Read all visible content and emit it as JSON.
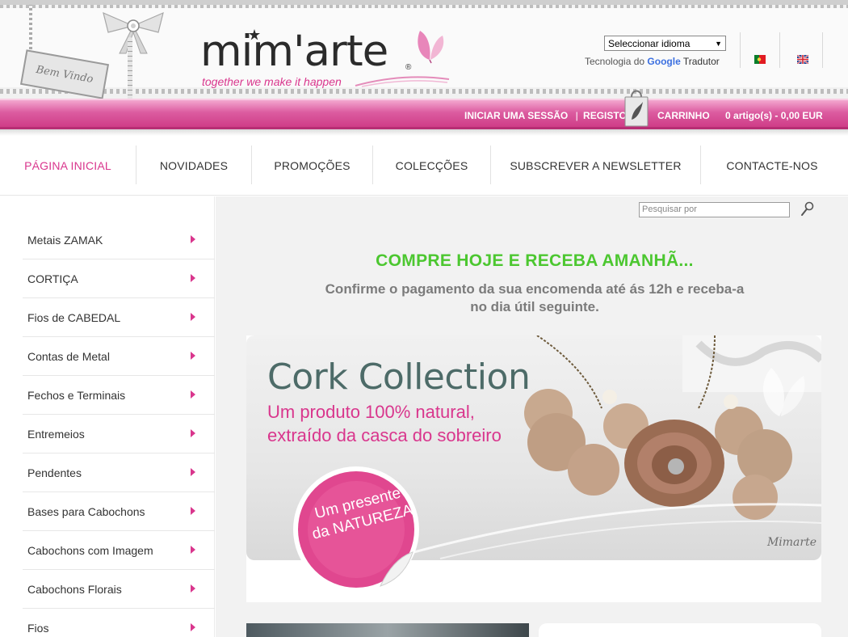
{
  "header": {
    "welcome_tag": "Bem Vindo",
    "logo_text": "mim'arte",
    "logo_reg": "®",
    "tagline": "together we make it happen",
    "language_select": {
      "selected": "Seleccionar idioma"
    },
    "powered_by": {
      "prefix": "Tecnologia do",
      "google": "Google",
      "suffix": "Tradutor"
    },
    "flags": [
      "portugal-flag-icon",
      "uk-flag-icon"
    ]
  },
  "topbar": {
    "login": "INICIAR UMA SESSÃO",
    "divider": "|",
    "register": "REGISTO",
    "cart_label": "CARRINHO",
    "cart_amount": "0 artigo(s) - 0,00 EUR"
  },
  "nav": {
    "items": [
      {
        "label": "PÁGINA INICIAL",
        "active": true
      },
      {
        "label": "NOVIDADES"
      },
      {
        "label": "PROMOÇÕES"
      },
      {
        "label": "COLECÇÕES"
      },
      {
        "label": "SUBSCREVER A NEWSLETTER"
      },
      {
        "label": "CONTACTE-NOS"
      }
    ]
  },
  "sidebar": {
    "items": [
      {
        "label": "Metais ZAMAK"
      },
      {
        "label": "CORTIÇA"
      },
      {
        "label": "Fios de CABEDAL"
      },
      {
        "label": "Contas de Metal"
      },
      {
        "label": "Fechos e Terminais"
      },
      {
        "label": "Entremeios"
      },
      {
        "label": "Pendentes"
      },
      {
        "label": "Bases para Cabochons"
      },
      {
        "label": "Cabochons com Imagem"
      },
      {
        "label": "Cabochons Florais"
      },
      {
        "label": "Fios"
      }
    ]
  },
  "search": {
    "placeholder": "Pesquisar por"
  },
  "promo": {
    "title": "COMPRE HOJE E RECEBA AMANHÃ...",
    "subtitle_line1": "Confirme o pagamento da sua encomenda até ás 12h e receba-a",
    "subtitle_line2": "no dia útil seguinte."
  },
  "banner": {
    "title": "Cork Collection",
    "line1": "Um produto 100% natural,",
    "line2": "extraído da casca do sobreiro",
    "badge_line1": "Um presente",
    "badge_line2": "da NATUREZA",
    "signature": "Mimarte"
  },
  "colors": {
    "brand_pink": "#d9368d",
    "promo_green": "#4cc730",
    "banner_title": "#4d6b68"
  }
}
